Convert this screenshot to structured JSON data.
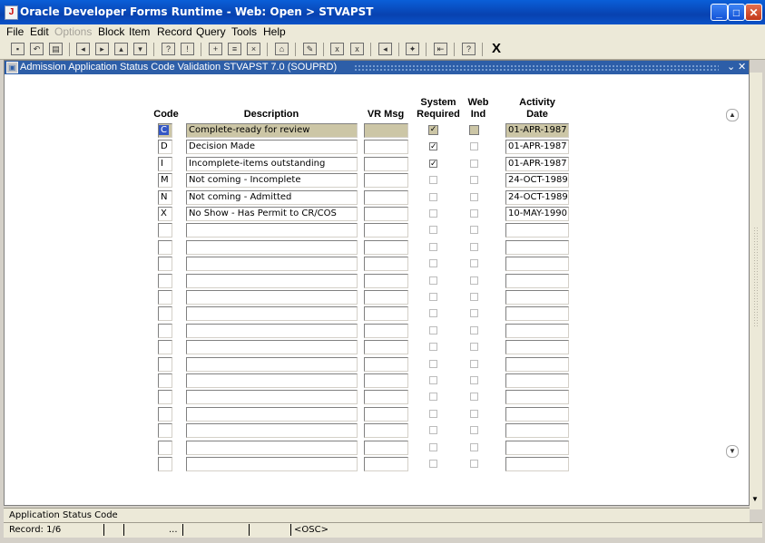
{
  "window": {
    "title": "Oracle Developer Forms Runtime - Web:  Open > STVAPST",
    "app_icon": "java-cup-icon",
    "controls": [
      "minimize-icon",
      "maximize-icon",
      "close-icon"
    ]
  },
  "menu": [
    "File",
    "Edit",
    "Options",
    "Block",
    "Item",
    "Record",
    "Query",
    "Tools",
    "Help"
  ],
  "toolbar": {
    "close_glyph": "X",
    "icons": [
      "save-icon",
      "rollback-icon",
      "print-icon",
      "previous-block-icon",
      "next-block-icon",
      "previous-record-icon",
      "next-record-icon",
      "enter-query-icon",
      "execute-query-icon",
      "insert-record-icon",
      "remove-record-icon",
      "print-form-icon",
      "edit-icon",
      "count-icon",
      "list-icon",
      "lov-icon",
      "exit-icon",
      "help-icon"
    ]
  },
  "form": {
    "title": "Admission Application Status Code Validation  STVAPST  7.0  (SOUPRD)",
    "frame_buttons": [
      "minimize-frame-icon",
      "close-frame-icon"
    ],
    "columns": {
      "code": "Code",
      "description": "Description",
      "vr_msg": "VR Msg",
      "system_required_1": "System",
      "system_required_2": "Required",
      "web_ind_1": "Web",
      "web_ind_2": "Ind",
      "activity_date_1": "Activity",
      "activity_date_2": "Date"
    },
    "records": [
      {
        "code": "C",
        "description": "Complete-ready for review",
        "vr_msg": "",
        "system_required": true,
        "web_ind": false,
        "activity_date": "01-APR-1987"
      },
      {
        "code": "D",
        "description": "Decision Made",
        "vr_msg": "",
        "system_required": true,
        "web_ind": false,
        "activity_date": "01-APR-1987"
      },
      {
        "code": "I",
        "description": "Incomplete-items outstanding",
        "vr_msg": "",
        "system_required": true,
        "web_ind": false,
        "activity_date": "01-APR-1987"
      },
      {
        "code": "M",
        "description": "Not coming - Incomplete",
        "vr_msg": "",
        "system_required": false,
        "web_ind": false,
        "activity_date": "24-OCT-1989"
      },
      {
        "code": "N",
        "description": "Not coming - Admitted",
        "vr_msg": "",
        "system_required": false,
        "web_ind": false,
        "activity_date": "24-OCT-1989"
      },
      {
        "code": "X",
        "description": "No Show - Has Permit to CR/COS",
        "vr_msg": "",
        "system_required": false,
        "web_ind": false,
        "activity_date": "10-MAY-1990"
      }
    ],
    "empty_rows": 15
  },
  "status": {
    "hint": "Application Status Code",
    "record": "Record: 1/6",
    "ellipsis": "...",
    "osc": "<OSC>"
  }
}
